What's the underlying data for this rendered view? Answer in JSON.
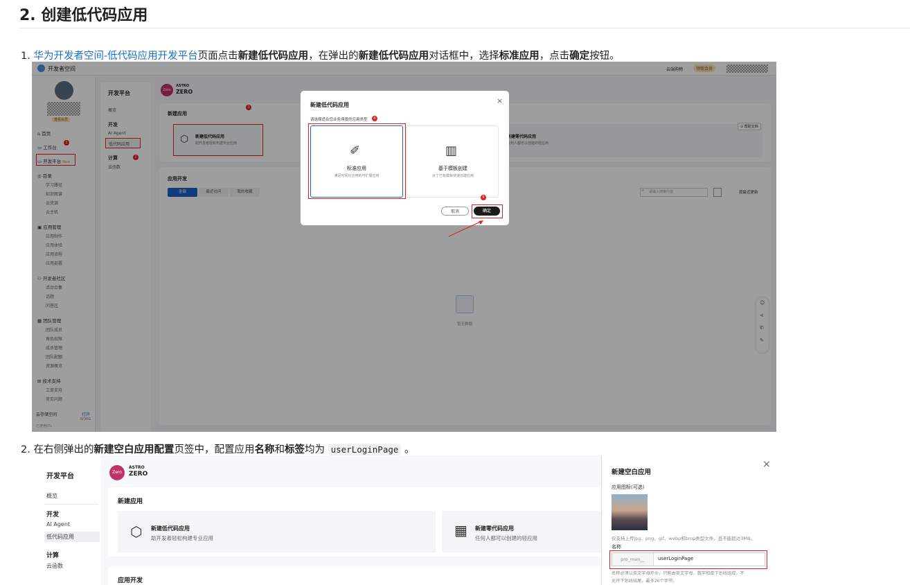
{
  "heading": "2. 创建低代码应用",
  "step1": {
    "num": "1.",
    "link": "华为开发者空间-低代码应用开发平台",
    "t1": "页面点击",
    "b1": "新建低代码应用",
    "t2": "，在弹出的",
    "b2": "新建低代码应用",
    "t3": "对话框中，选择",
    "b3": "标准应用",
    "t4": "，点击",
    "b4": "确定",
    "t5": "按钮。"
  },
  "step2": {
    "num": "2.",
    "t1": "在右侧弹出的",
    "b1": "新建空白应用配置",
    "t2": "页签中，配置应用",
    "b2": "名称",
    "t3": "和",
    "b3": "标签",
    "t4": "均为",
    "code": "userLoginPage",
    "t5": "。"
  },
  "shot1": {
    "app_title": "开发者空间",
    "header_right": [
      "云端购物",
      "领取会员"
    ],
    "badge": "领取会员",
    "user_tag": "查看会员",
    "nav": [
      {
        "label": "首页"
      },
      {
        "label": "工作台"
      },
      {
        "label": "开发平台",
        "tag": "New"
      },
      {
        "label": "目录",
        "subs": [
          "学习路径",
          "知识图谱",
          "云资源",
          "云主机"
        ]
      },
      {
        "label": "应用管理",
        "subs": [
          "应用制作",
          "应用体验",
          "应用流程",
          "应用部署"
        ]
      },
      {
        "label": "开发者社区",
        "subs": [
          "活动合集",
          "话题",
          "问答区"
        ]
      },
      {
        "label": "团队管理",
        "subs": [
          "团队成员",
          "角色权限",
          "成员管理",
          "团队配额",
          "资源概览"
        ]
      },
      {
        "label": "技术支持",
        "subs": [
          "工单支持",
          "常见问题"
        ]
      }
    ],
    "storage_label": "云存储空间",
    "storage_link": "打开",
    "storage_value": "0/30G",
    "footer_small": "已使用0%",
    "panel_title": "开发平台",
    "panel_items": [
      "概览",
      "开发",
      "AI Agent",
      "低代码应用",
      "计算",
      "云函数"
    ],
    "logo_badge": "Zero",
    "logo_text1": "ASTRO",
    "logo_text2": "ZERO",
    "section_new": "新建应用",
    "new_card_title": "新建低代码应用",
    "new_card_desc": "助开发者轻松构建专业应用",
    "second_card_title": "新建零代码应用",
    "second_card_desc": "任何人都可以创建的轻应用",
    "help_link": "帮助文档",
    "section_dev": "应用开发",
    "tabs": [
      "全部",
      "最近访问",
      "我的收藏"
    ],
    "search_placeholder": "请输入搜索内容",
    "sort_label": "按最近更新",
    "empty_text": "暂无数据",
    "dialog": {
      "title": "新建低代码应用",
      "prompt": "请选择适合您业务场景的应用类型",
      "opt1_title": "标准应用",
      "opt1_desc": "满足可视化应用的可扩展应用",
      "opt2_title": "基于模板创建",
      "opt2_desc": "从丁已有模板快速创建应用",
      "cancel": "取消",
      "ok": "确定",
      "close": "×"
    },
    "markers": [
      "1",
      "2",
      "3",
      "4",
      "5",
      "6"
    ]
  },
  "shot2": {
    "panel_title": "开发平台",
    "panel_items": [
      "概览",
      "开发",
      "AI Agent",
      "低代码应用",
      "计算",
      "云函数"
    ],
    "logo_badge": "Zero",
    "logo_text1": "ASTRO",
    "logo_text2": "ZERO",
    "section_new": "新建应用",
    "card1_title": "新建低代码应用",
    "card1_desc": "助开发者轻松构建专业应用",
    "card2_title": "新建零代码应用",
    "card2_desc": "任何人都可以创建的轻应用",
    "section_dev": "应用开发",
    "drawer": {
      "title": "新建空白应用",
      "close": "×",
      "icon_label": "应用图标(可选)",
      "icon_hint": "仅支持上传jpg、png、gif、webp和bmp类型文件，且不能超过3MB。",
      "name_label": "名称",
      "name_prefix": "pro_man__",
      "name_value": "userLoginPage",
      "name_hint1": "名称必须以英文字母开头，只能由英文字母、数字和单下划线组成，不",
      "name_hint2": "允许下划线结尾，最多26个字节。"
    }
  }
}
